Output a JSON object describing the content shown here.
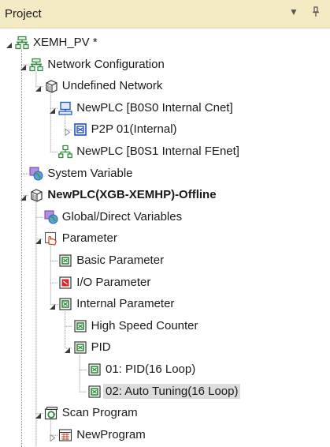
{
  "panel": {
    "title": "Project",
    "dropdown_icon": "triangle-down-icon",
    "pin_icon": "pin-icon"
  },
  "tree": [
    {
      "label": "XEMH_PV *",
      "level": 0,
      "icon": "project-icon",
      "expander": "expanded",
      "bold": false,
      "selected": false
    },
    {
      "label": "Network Configuration",
      "level": 1,
      "icon": "network-config-icon",
      "expander": "expanded",
      "bold": false,
      "selected": false
    },
    {
      "label": "Undefined Network",
      "level": 2,
      "icon": "network-cube-icon",
      "expander": "expanded",
      "bold": false,
      "selected": false
    },
    {
      "label": "NewPLC [B0S0 Internal Cnet]",
      "level": 3,
      "icon": "cnet-plc-icon",
      "expander": "expanded",
      "bold": false,
      "selected": false
    },
    {
      "label": "P2P 01(Internal)",
      "level": 4,
      "icon": "p2p-parameter-icon",
      "expander": "collapsed",
      "bold": false,
      "selected": false
    },
    {
      "label": "NewPLC [B0S1 Internal FEnet]",
      "level": 3,
      "icon": "fenet-plc-icon",
      "expander": "none",
      "bold": false,
      "selected": false
    },
    {
      "label": "System Variable",
      "level": 1,
      "icon": "variable-globe-icon",
      "expander": "none",
      "bold": false,
      "selected": false
    },
    {
      "label": "NewPLC(XGB-XEMHP)-Offline",
      "level": 1,
      "icon": "plc-cube-icon",
      "expander": "expanded",
      "bold": true,
      "selected": false
    },
    {
      "label": "Global/Direct Variables",
      "level": 2,
      "icon": "variable-globe-icon",
      "expander": "none",
      "bold": false,
      "selected": false
    },
    {
      "label": "Parameter",
      "level": 2,
      "icon": "parameter-hand-icon",
      "expander": "expanded",
      "bold": false,
      "selected": false
    },
    {
      "label": "Basic Parameter",
      "level": 3,
      "icon": "basic-parameter-icon",
      "expander": "none",
      "bold": false,
      "selected": false
    },
    {
      "label": "I/O Parameter",
      "level": 3,
      "icon": "io-parameter-icon",
      "expander": "none",
      "bold": false,
      "selected": false
    },
    {
      "label": "Internal Parameter",
      "level": 3,
      "icon": "internal-parameter-icon",
      "expander": "expanded",
      "bold": false,
      "selected": false
    },
    {
      "label": "High Speed Counter",
      "level": 4,
      "icon": "parameter-module-icon",
      "expander": "none",
      "bold": false,
      "selected": false
    },
    {
      "label": "PID",
      "level": 4,
      "icon": "parameter-module-icon",
      "expander": "expanded",
      "bold": false,
      "selected": false
    },
    {
      "label": "01: PID(16 Loop)",
      "level": 5,
      "icon": "parameter-module-icon",
      "expander": "none",
      "bold": false,
      "selected": false
    },
    {
      "label": "02: Auto Tuning(16 Loop)",
      "level": 5,
      "icon": "parameter-module-icon",
      "expander": "none",
      "bold": false,
      "selected": true
    },
    {
      "label": "Scan Program",
      "level": 2,
      "icon": "scan-program-icon",
      "expander": "expanded",
      "bold": false,
      "selected": false
    },
    {
      "label": "NewProgram",
      "level": 3,
      "icon": "ladder-program-icon",
      "expander": "collapsed",
      "bold": false,
      "selected": false
    }
  ],
  "colors": {
    "titlebar_bg": "#f4eac4",
    "selection_bg": "#dcdcdc",
    "tree_lines": "#8a8a8a",
    "icon_green": "#2f8a3a",
    "icon_blue": "#1f4fbf",
    "icon_red": "#d8262b"
  }
}
